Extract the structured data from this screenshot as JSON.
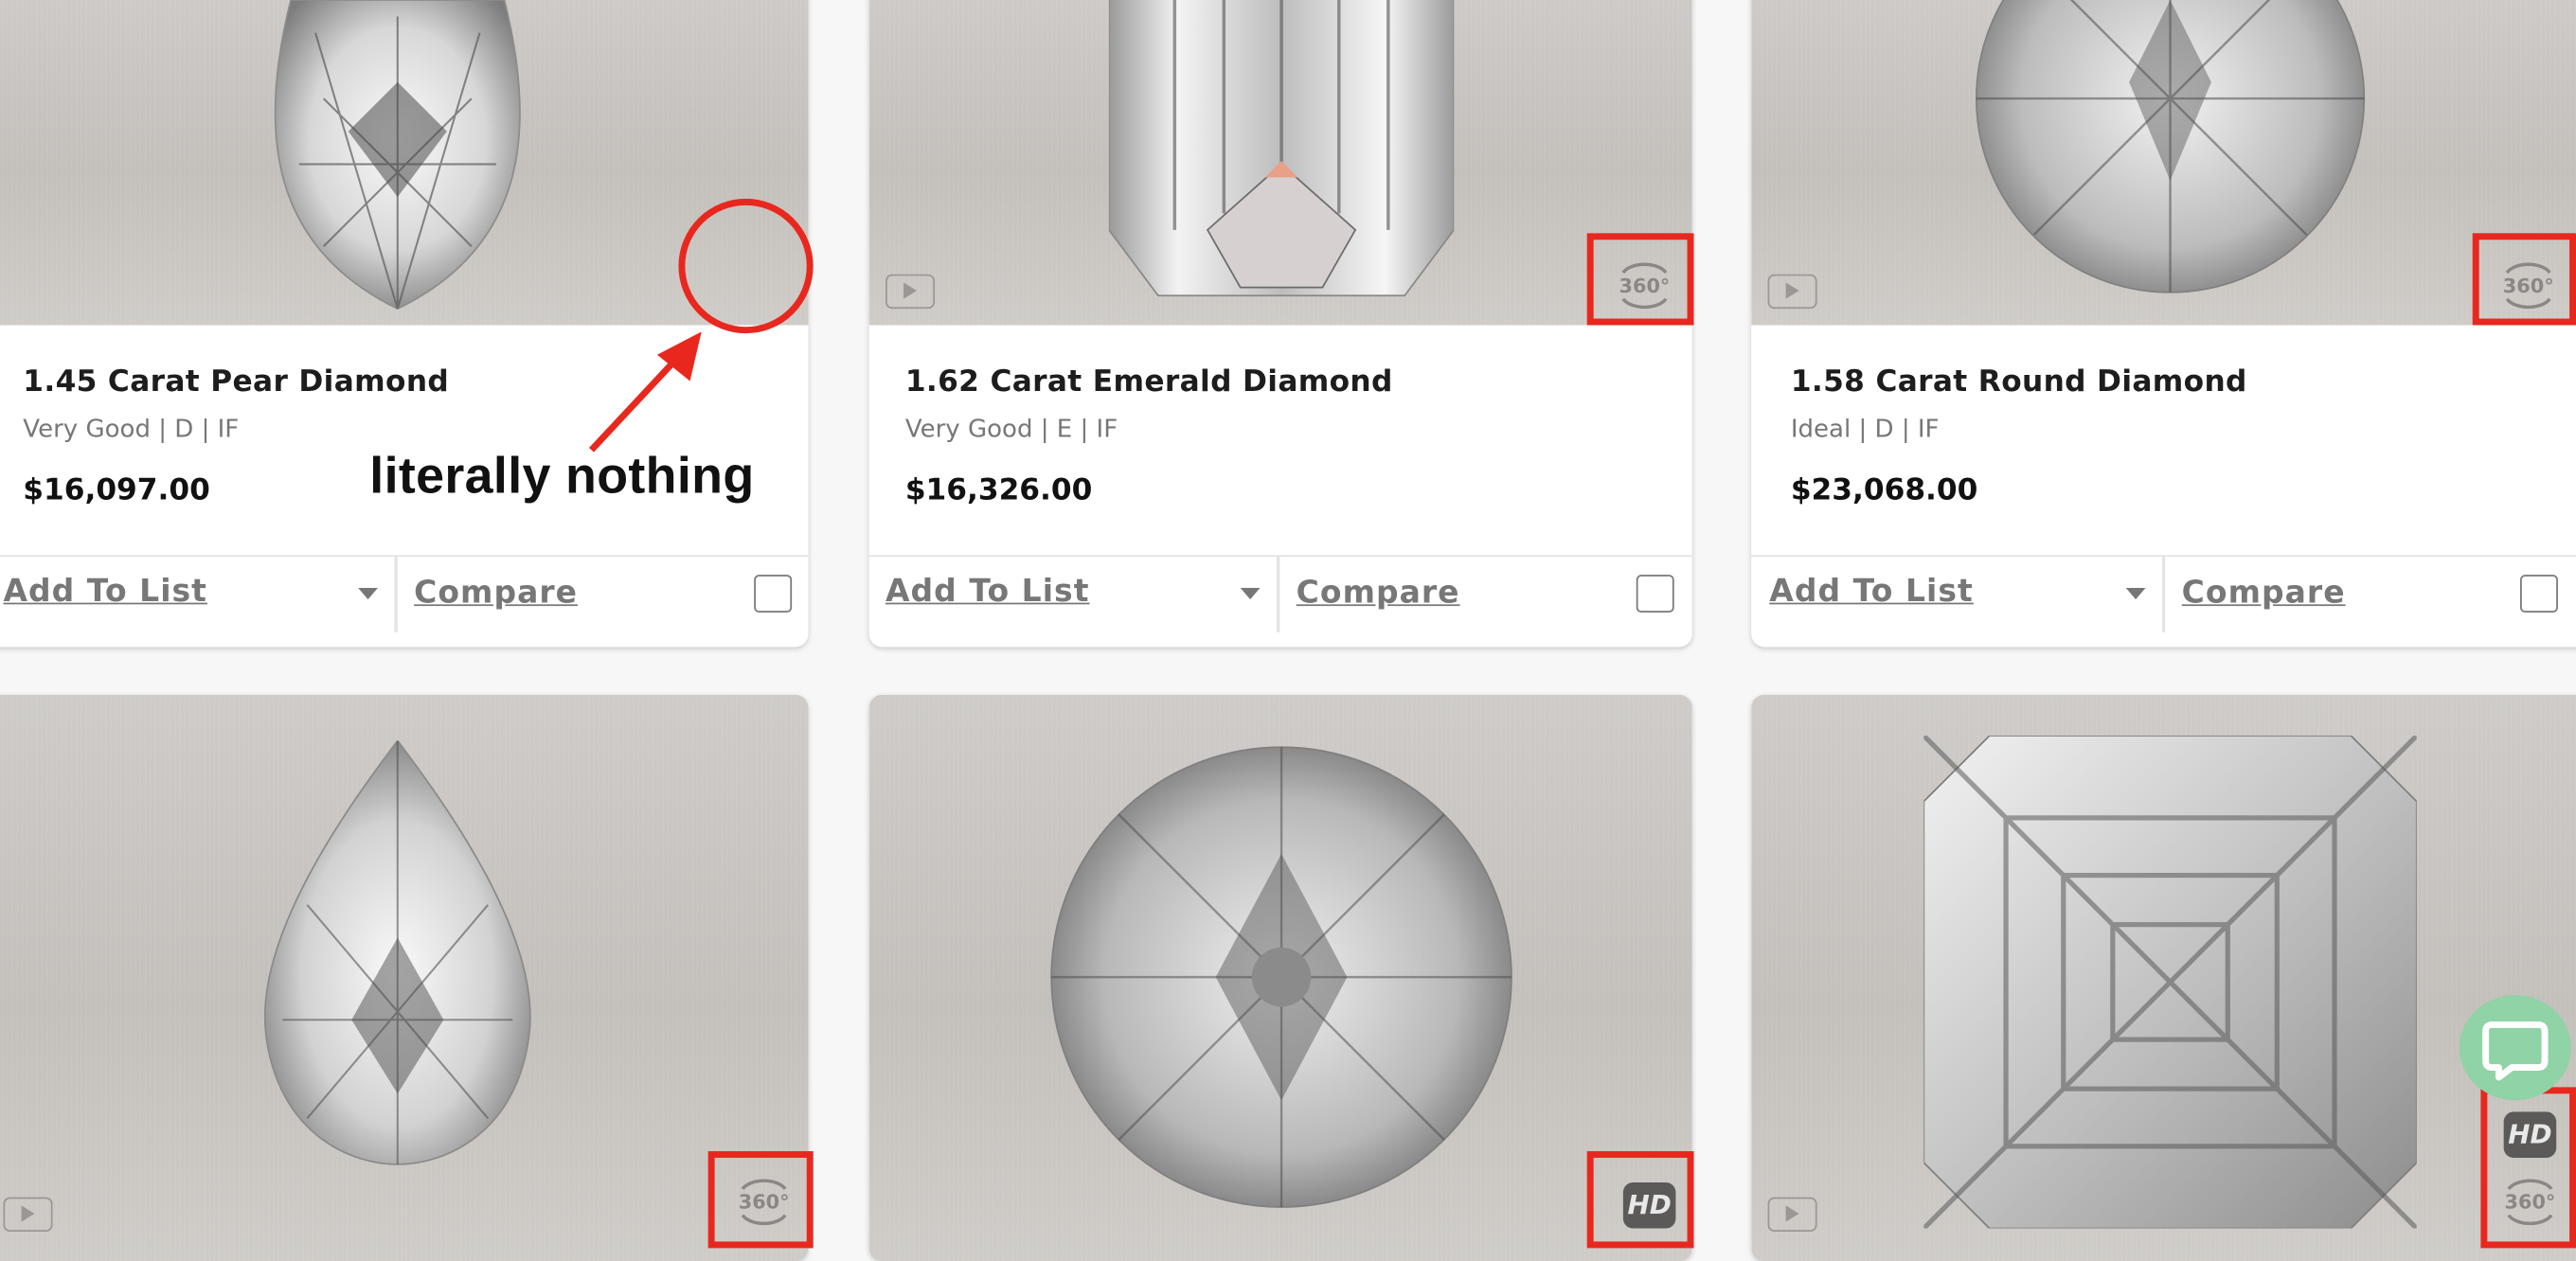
{
  "cards": [
    {
      "title": "1.45 Carat Pear Diamond",
      "specs": "Very Good | D | IF",
      "price": "$16,097.00",
      "add_label": "Add To List",
      "compare_label": "Compare"
    },
    {
      "title": "1.62 Carat Emerald Diamond",
      "specs": "Very Good | E | IF",
      "price": "$16,326.00",
      "add_label": "Add To List",
      "compare_label": "Compare"
    },
    {
      "title": "1.58 Carat Round Diamond",
      "specs": "Ideal | D | IF",
      "price": "$23,068.00",
      "add_label": "Add To List",
      "compare_label": "Compare"
    }
  ],
  "badges": {
    "label_360": "360°",
    "label_hd": "HD"
  },
  "annotation": {
    "text": "literally nothing",
    "color": "#e8281e"
  },
  "icons": [
    "play-icon",
    "360-icon",
    "hd-icon",
    "chat-icon",
    "checkbox-icon",
    "caret-down-icon"
  ]
}
